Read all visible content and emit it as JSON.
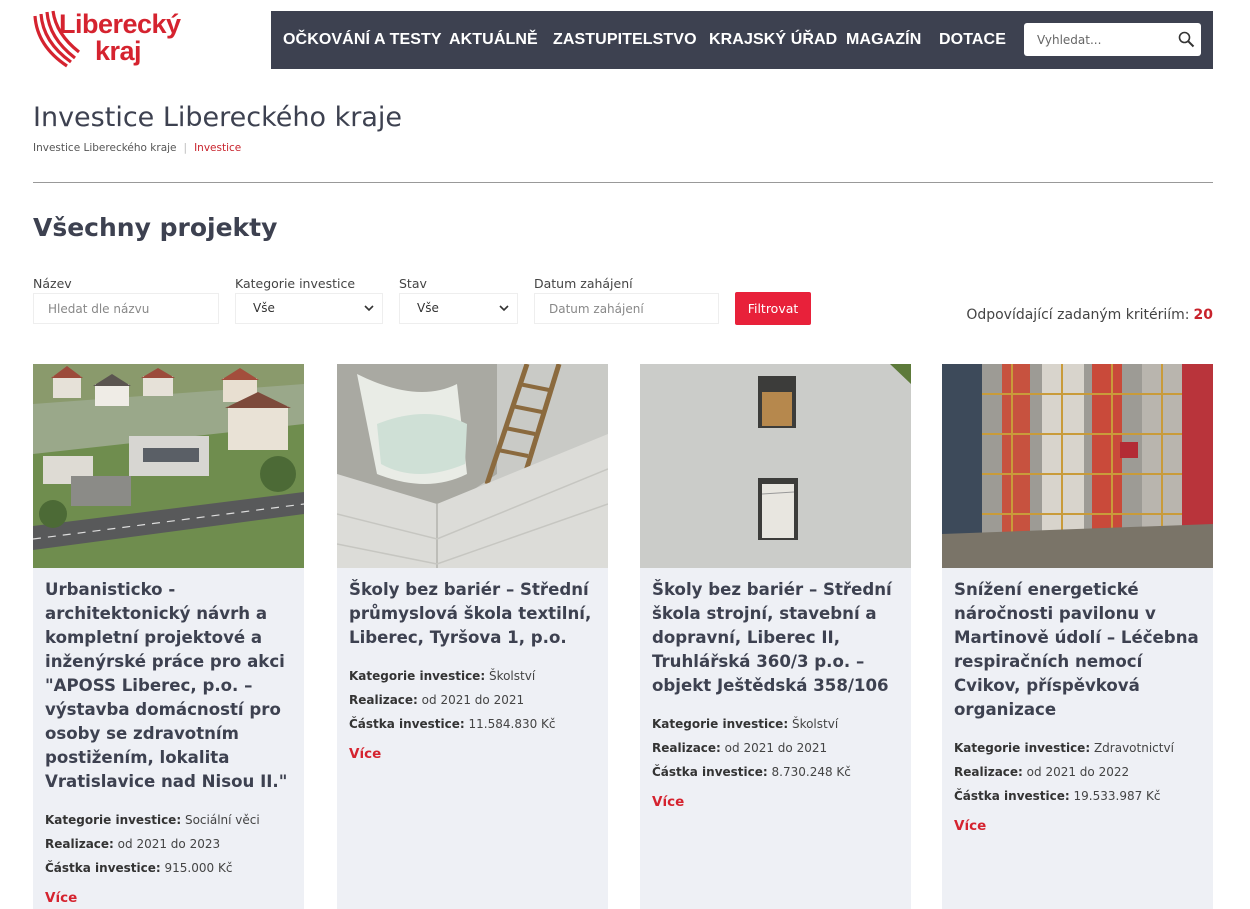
{
  "logo": {
    "line1": "Liberecký",
    "line2": "kraj"
  },
  "nav": [
    "OČKOVÁNÍ A TESTY",
    "AKTUÁLNĚ",
    "ZASTUPITELSTVO",
    "KRAJSKÝ ÚŘAD",
    "MAGAZÍN",
    "DOTACE"
  ],
  "search": {
    "placeholder": "Vyhledat..."
  },
  "page": {
    "title": "Investice Libereckého kraje",
    "breadcrumb": [
      "Investice Libereckého kraje",
      "Investice"
    ],
    "section_title": "Všechny projekty"
  },
  "filters": {
    "name": {
      "label": "Název",
      "placeholder": "Hledat dle názvu"
    },
    "category": {
      "label": "Kategorie investice",
      "value": "Vše"
    },
    "status": {
      "label": "Stav",
      "value": "Vše"
    },
    "start_date": {
      "label": "Datum zahájení",
      "placeholder": "Datum zahájení"
    },
    "button": "Filtrovat",
    "results_label": "Odpovídající zadaným kritériím:",
    "results_count": "20"
  },
  "labels": {
    "category": "Kategorie investice:",
    "realization": "Realizace:",
    "amount": "Částka investice:",
    "more": "Více"
  },
  "projects": [
    {
      "title": "Urbanisticko - architektonický návrh a kompletní projektové a inženýrské práce pro akci \"APOSS Liberec, p.o. – výstavba domácností pro osoby se zdravotním postižením, lokalita Vratislavice nad Nisou II.\"",
      "category": "Sociální věci",
      "realization": "od 2021 do 2023",
      "amount": "915.000 Kč"
    },
    {
      "title": "Školy bez bariér – Střední průmyslová škola textilní, Liberec, Tyršova 1, p.o.",
      "category": "Školství",
      "realization": "od 2021 do 2021",
      "amount": "11.584.830 Kč"
    },
    {
      "title": "Školy bez bariér – Střední škola strojní, stavební a dopravní, Liberec II, Truhlářská 360/3 p.o. – objekt Ještědská 358/106",
      "category": "Školství",
      "realization": "od 2021 do 2021",
      "amount": "8.730.248 Kč"
    },
    {
      "title": "Snížení energetické náročnosti pavilonu v Martinově údolí – Léčebna respiračních nemocí Cvikov, příspěvková organizace",
      "category": "Zdravotnictví",
      "realization": "od 2021 do 2022",
      "amount": "19.533.987 Kč"
    }
  ],
  "colors": {
    "brand_red": "#d5232f",
    "nav_bg": "#3d4150",
    "card_bg": "#eef0f5",
    "button_red": "#e8213a"
  }
}
